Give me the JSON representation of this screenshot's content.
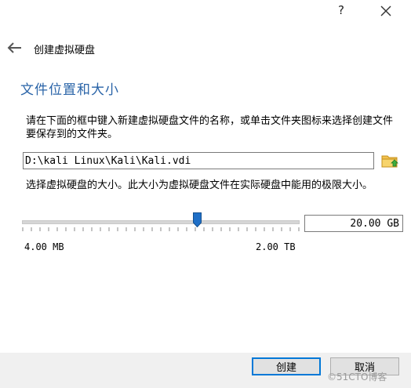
{
  "titlebar": {
    "help_label": "?",
    "close_icon": "close-icon"
  },
  "header": {
    "back_icon": "arrow-left-icon",
    "title": "创建虚拟硬盘"
  },
  "content": {
    "heading": "文件位置和大小",
    "location_description": "请在下面的框中键入新建虚拟硬盘文件的名称，或单击文件夹图标来选择创建文件要保存到的文件夹。",
    "file_path": "D:\\kali Linux\\Kali\\Kali.vdi",
    "folder_icon": "folder-browse-icon",
    "size_description": "选择虚拟硬盘的大小。此大小为虚拟硬盘文件在实际硬盘中能用的极限大小。",
    "size_value": "20.00 GB",
    "range_min": "4.00 MB",
    "range_max": "2.00 TB"
  },
  "footer": {
    "create_label": "创建",
    "cancel_label": "取消",
    "watermark": "©51CTO博客"
  },
  "colors": {
    "heading": "#2a64a8",
    "handle": "#1f6fc7",
    "default_button_border": "#0078d7",
    "footer_bg": "#f0f0f0"
  }
}
